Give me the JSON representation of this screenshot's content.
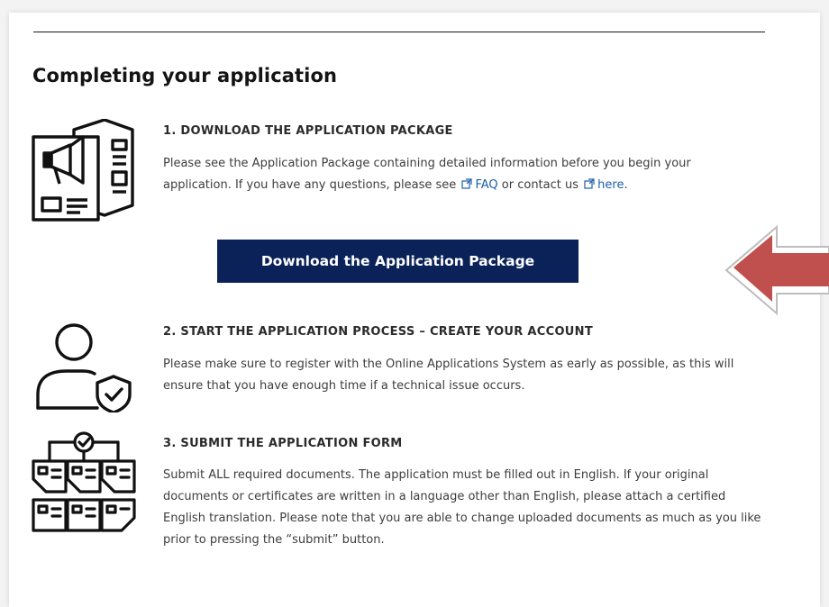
{
  "section_title": "Completing your application",
  "steps": [
    {
      "icon": "poster-document-icon",
      "title": "1. DOWNLOAD THE APPLICATION PACKAGE",
      "text_before": "Please see the Application Package containing detailed information before you begin your application. If you have any questions, please see",
      "link1_label": "FAQ",
      "text_middle": "or contact us",
      "link2_label": "here",
      "text_after": "."
    },
    {
      "icon": "user-shield-icon",
      "title": "2. START THE APPLICATION PROCESS – CREATE YOUR ACCOUNT",
      "text": "Please make sure to register with the Online Applications System as early as possible, as this will ensure that you have enough time if a technical issue occurs."
    },
    {
      "icon": "document-workflow-icon",
      "title": "3. SUBMIT THE APPLICATION FORM",
      "text": "Submit ALL required documents. The application must be filled out in English. If your original documents or certificates are written in a language other than English, please attach a certified English translation. Please note that you are able to change uploaded documents as much as you like prior to pressing the “submit” button."
    }
  ],
  "download_button_label": "Download the Application Package",
  "colors": {
    "button_bg": "#0a2257",
    "link": "#1d5fa8",
    "arrow": "#c0504d"
  }
}
